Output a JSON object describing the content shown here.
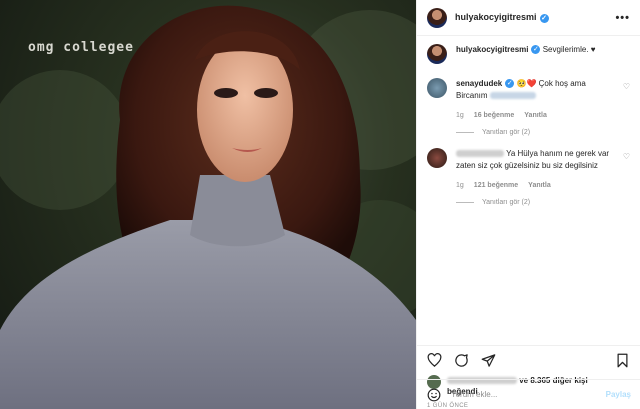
{
  "photo": {
    "watermark": "omg collegee"
  },
  "header": {
    "username": "hulyakocyigitresmi"
  },
  "caption": {
    "username": "hulyakocyigitresmi",
    "text": "Sevgilerimle. ♥"
  },
  "comments": [
    {
      "username": "senaydudek",
      "text": "🥺❤️ Çok hoş ama Bircanım",
      "time": "1g",
      "likes": "16 beğenme",
      "reply": "Yanıtla",
      "view_replies": "Yanıtları gör (2)"
    },
    {
      "username": "",
      "text": "Ya Hülya hanım ne gerek var zaten siz çok güzelsiniz bu siz degilsiniz",
      "time": "1g",
      "likes": "121 beğenme",
      "reply": "Yanıtla",
      "view_replies": "Yanıtları gör (2)"
    }
  ],
  "likes": {
    "text": "ve 8.365 diğer kişi",
    "suffix": "beğendi"
  },
  "date": "1 GÜN ÖNCE",
  "add_comment": {
    "placeholder": "Yorum ekle...",
    "post_label": "Paylaş"
  },
  "colors": {
    "verified": "#3897f0",
    "post_disabled": "#b2dffc"
  }
}
